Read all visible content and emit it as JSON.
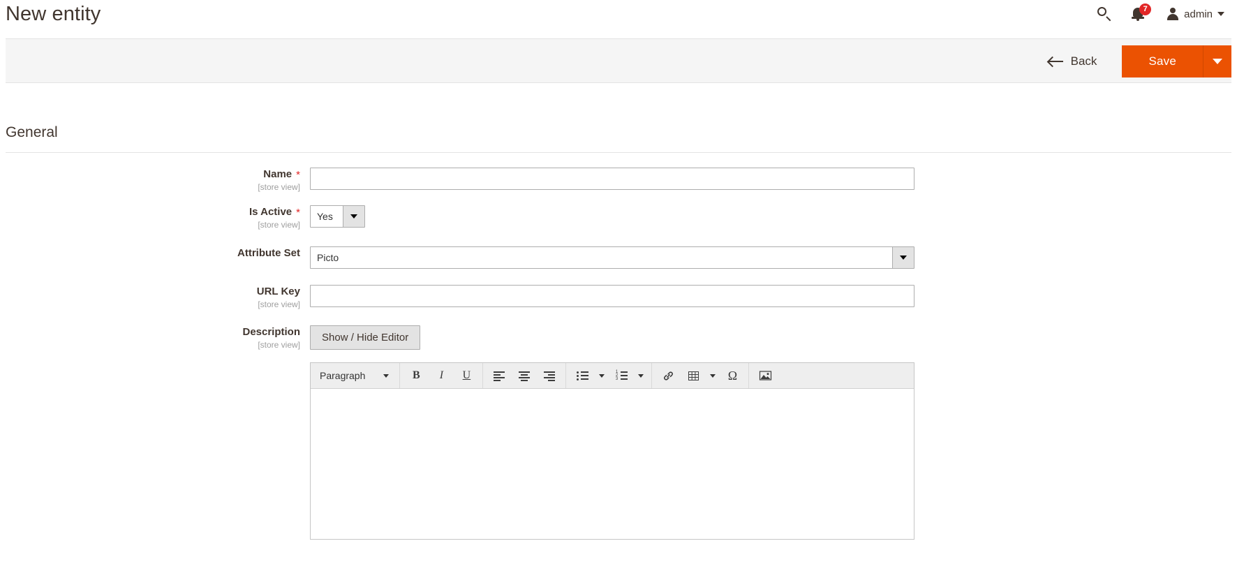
{
  "header": {
    "title": "New entity",
    "search_icon": "search-icon",
    "notifications": {
      "icon": "bell-icon",
      "count": "7"
    },
    "user": {
      "avatar_icon": "user-avatar-icon",
      "name": "admin",
      "caret_icon": "chevron-down-icon"
    }
  },
  "actions": {
    "back_label": "Back",
    "back_icon": "arrow-left-icon",
    "save_label": "Save",
    "save_toggle_icon": "chevron-down-icon",
    "accent_color": "#eb5202"
  },
  "section": {
    "title": "General"
  },
  "form": {
    "scope_note": "[store view]",
    "required_marker": "*",
    "fields": [
      {
        "label": "Name",
        "required": true,
        "scope": "[store view]",
        "type": "text",
        "value": "",
        "placeholder": ""
      },
      {
        "label": "Is Active",
        "required": true,
        "scope": "[store view]",
        "type": "select",
        "value": "Yes"
      },
      {
        "label": "Attribute Set",
        "required": false,
        "scope": "",
        "type": "select",
        "value": "Picto"
      },
      {
        "label": "URL Key",
        "required": true,
        "scope": "[store view]",
        "type": "text",
        "value": "",
        "placeholder": ""
      },
      {
        "label": "Description",
        "required": false,
        "scope": "[store view]",
        "type": "wysiwyg",
        "value": ""
      }
    ],
    "description": {
      "toggle_label": "Show / Hide Editor"
    }
  },
  "editor": {
    "format_select": "Paragraph",
    "buttons": [
      {
        "name": "bold-icon",
        "glyph": "B"
      },
      {
        "name": "italic-icon",
        "glyph": "I"
      },
      {
        "name": "underline-icon",
        "glyph": "U"
      },
      {
        "name": "align-left-icon",
        "glyph": ""
      },
      {
        "name": "align-center-icon",
        "glyph": ""
      },
      {
        "name": "align-right-icon",
        "glyph": ""
      },
      {
        "name": "bullet-list-icon",
        "glyph": ""
      },
      {
        "name": "numbered-list-icon",
        "glyph": ""
      },
      {
        "name": "link-icon",
        "glyph": "ὑ7"
      },
      {
        "name": "table-icon",
        "glyph": ""
      },
      {
        "name": "special-character-icon",
        "glyph": "Ω"
      },
      {
        "name": "insert-image-icon",
        "glyph": ""
      }
    ],
    "special_char_glyph": "Ω",
    "content": ""
  }
}
